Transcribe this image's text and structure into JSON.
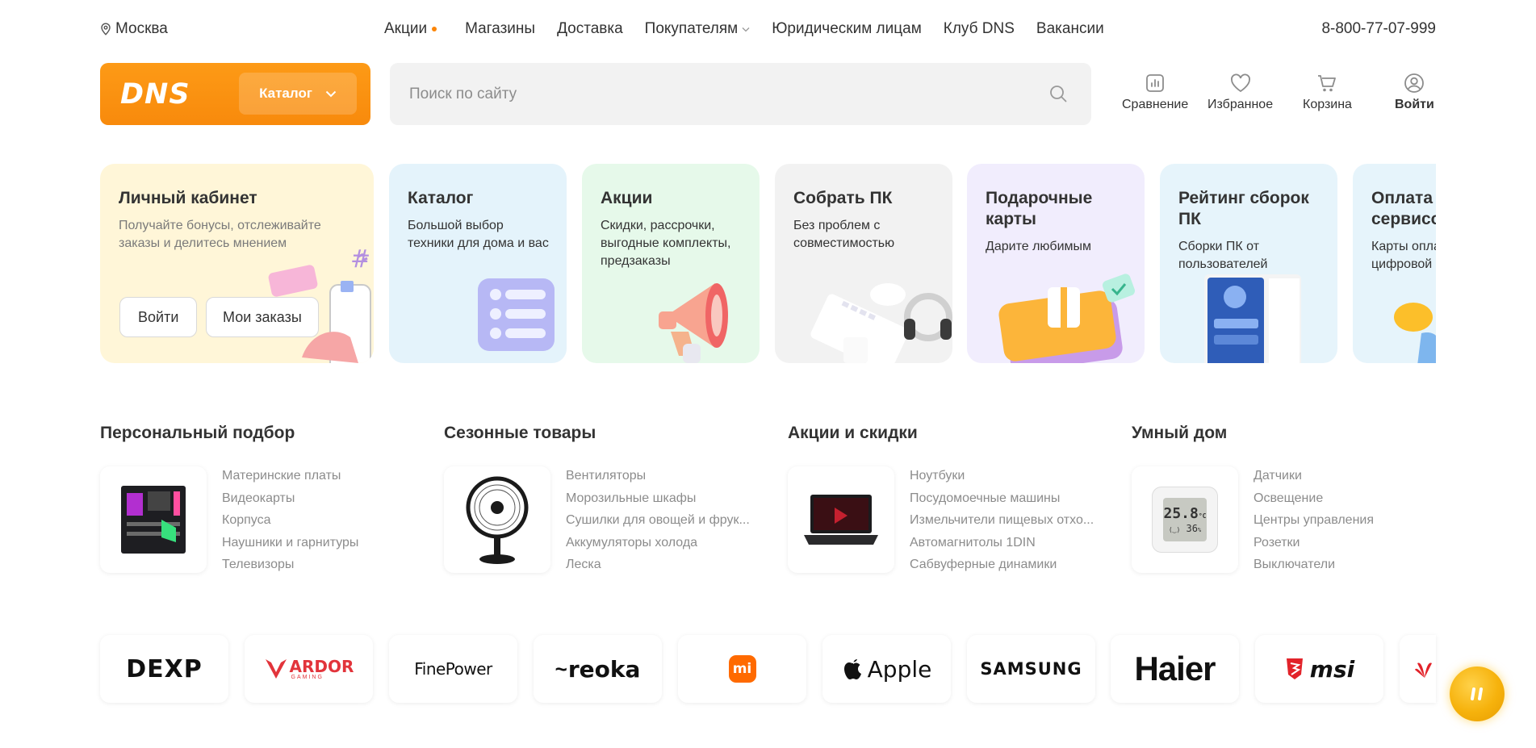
{
  "topbar": {
    "city": "Москва",
    "nav": [
      {
        "label": "Акции",
        "dot": true
      },
      {
        "label": "Магазины"
      },
      {
        "label": "Доставка"
      },
      {
        "label": "Покупателям",
        "dropdown": true
      },
      {
        "label": "Юридическим лицам"
      },
      {
        "label": "Клуб DNS"
      },
      {
        "label": "Вакансии"
      }
    ],
    "phone": "8-800-77-07-999"
  },
  "header": {
    "logo": "DNS",
    "catalog_label": "Каталог",
    "search_placeholder": "Поиск по сайту",
    "actions": [
      {
        "label": "Сравнение",
        "icon": "compare-icon"
      },
      {
        "label": "Избранное",
        "icon": "heart-icon"
      },
      {
        "label": "Корзина",
        "icon": "cart-icon"
      },
      {
        "label": "Войти",
        "icon": "user-icon"
      }
    ]
  },
  "cards": {
    "account": {
      "title": "Личный кабинет",
      "text": "Получайте бонусы, отслеживайте заказы и делитесь мнением",
      "login_label": "Войти",
      "orders_label": "Мои заказы"
    },
    "catalog": {
      "title": "Каталог",
      "text": "Большой выбор техники для дома и вас"
    },
    "promo": {
      "title": "Акции",
      "text": "Скидки, рассрочки, выгодные комплекты, предзаказы"
    },
    "build_pc": {
      "title": "Собрать ПК",
      "text": "Без проблем с совместимостью"
    },
    "gift": {
      "title": "Подарочные карты",
      "text": "Дарите любимым"
    },
    "rating": {
      "title": "Рейтинг сборок ПК",
      "text": "Сборки ПК от пользователей"
    },
    "payment": {
      "title": "Оплата и сервисов",
      "text": "Карты опла цифровой"
    }
  },
  "categories": [
    {
      "title": "Персональный подбор",
      "image": "motherboard-image",
      "links": [
        "Материнские платы",
        "Видеокарты",
        "Корпуса",
        "Наушники и гарнитуры",
        "Телевизоры"
      ]
    },
    {
      "title": "Сезонные товары",
      "image": "fan-image",
      "links": [
        "Вентиляторы",
        "Морозильные шкафы",
        "Сушилки для овощей и фрук...",
        "Аккумуляторы холода",
        "Леска"
      ]
    },
    {
      "title": "Акции и скидки",
      "image": "laptop-image",
      "links": [
        "Ноутбуки",
        "Посудомоечные машины",
        "Измельчители пищевых отхо...",
        "Автомагнитолы 1DIN",
        "Сабвуферные динамики"
      ]
    },
    {
      "title": "Умный дом",
      "image": "sensor-image",
      "sensor_temp": "25.8",
      "sensor_unit": "°C",
      "sensor_hum": "36",
      "links": [
        "Датчики",
        "Освещение",
        "Центры управления",
        "Розетки",
        "Выключатели"
      ]
    }
  ],
  "brands": {
    "dexp": "DEXP",
    "ardor": "ARDOR",
    "ardor_sub": "GAMING",
    "finepower": "FinePower",
    "reoka": "reoka",
    "xiaomi": "mi",
    "apple": "Apple",
    "samsung": "SAMSUNG",
    "haier": "Haier",
    "msi": "msi"
  },
  "colors": {
    "accent": "#fc8507",
    "card_account": "#fff6d8",
    "card_catalog": "#e4f3fb",
    "card_promo": "#e6f9ea",
    "card_build": "#f2f2f2",
    "card_gift": "#f1edfd",
    "card_rating": "#e6f4fb",
    "card_payment": "#e6f4fb"
  }
}
